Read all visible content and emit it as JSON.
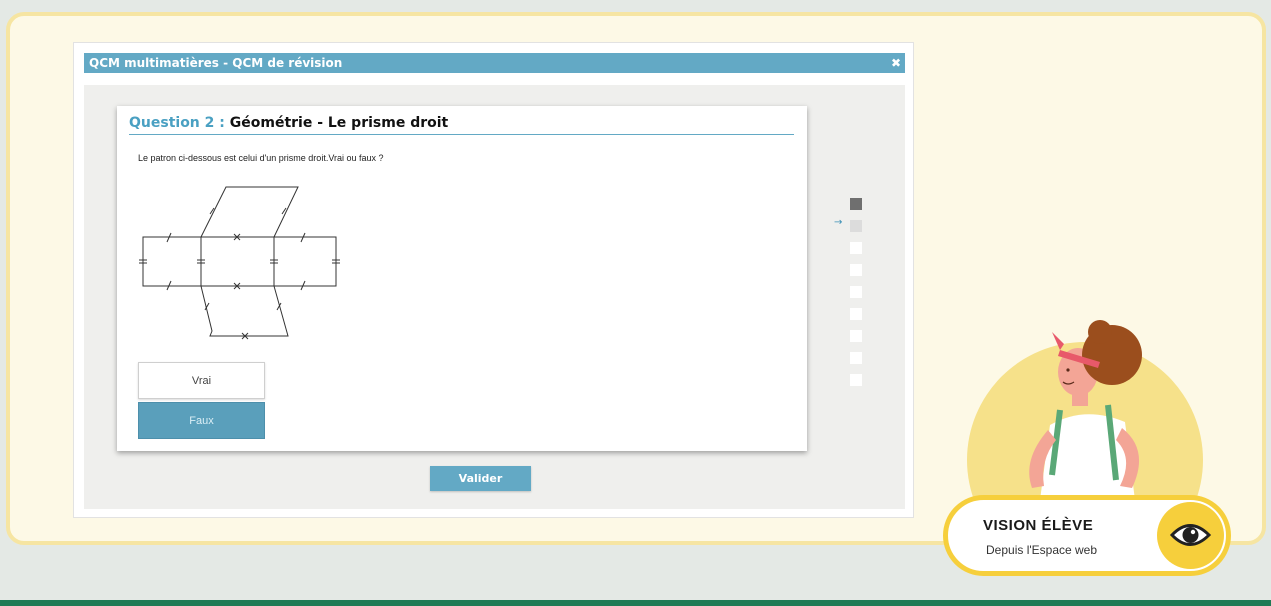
{
  "modal": {
    "title": "QCM multimatières - QCM de révision",
    "close_icon": "close-icon"
  },
  "question": {
    "number_label": "Question 2 :",
    "subject": "Géométrie - Le prisme droit",
    "text": "Le patron ci-dessous est celui d'un prisme droit.Vrai ou faux ?"
  },
  "answers": [
    {
      "label": "Vrai",
      "selected": false
    },
    {
      "label": "Faux",
      "selected": true
    }
  ],
  "validate_label": "Valider",
  "progress": {
    "total": 9,
    "answered": 1,
    "current_index": 2,
    "arrow_icon": "arrow-right-icon"
  },
  "badge": {
    "title": "VISION ÉLÈVE",
    "subtitle": "Depuis l'Espace web",
    "icon": "eye-icon"
  },
  "colors": {
    "header_blue": "#63a9c5",
    "selected_answer": "#5a9fbb",
    "panel_bg": "#fdf9e6",
    "panel_border": "#f6e5a2",
    "badge_yellow": "#f6cf3c"
  }
}
